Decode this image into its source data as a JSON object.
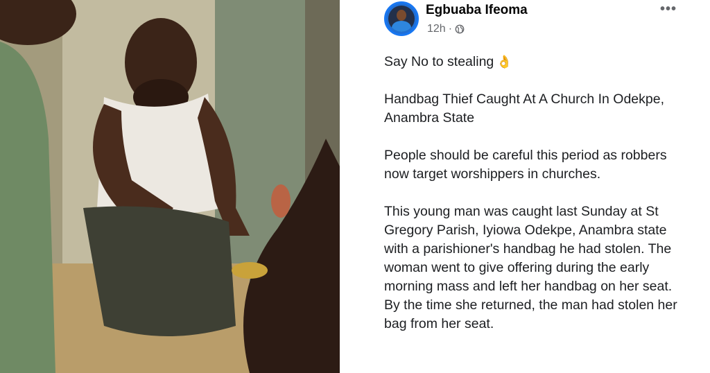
{
  "post": {
    "author": "Egbuaba Ifeoma",
    "time": "12h",
    "separator": "·",
    "visibility_icon": "globe-icon",
    "more_icon": "more-options-icon",
    "more_label": "•••",
    "emoji": "👌",
    "paragraphs": [
      "Say No to stealing",
      "Handbag Thief Caught At A Church In Odekpe, Anambra State",
      "People should be careful this period as robbers now target worshippers in churches.",
      "This young man was caught last Sunday at St Gregory Parish, Iyiowa Odekpe, Anambra state with a parishioner's handbag he had stolen. The woman went to give offering during the early morning mass and left her handbag on her seat. By the time she returned, the man had stolen her bag from her seat."
    ]
  },
  "colors": {
    "accent": "#1877f2",
    "meta_text": "#65676b",
    "body_text": "#1c1e21"
  }
}
